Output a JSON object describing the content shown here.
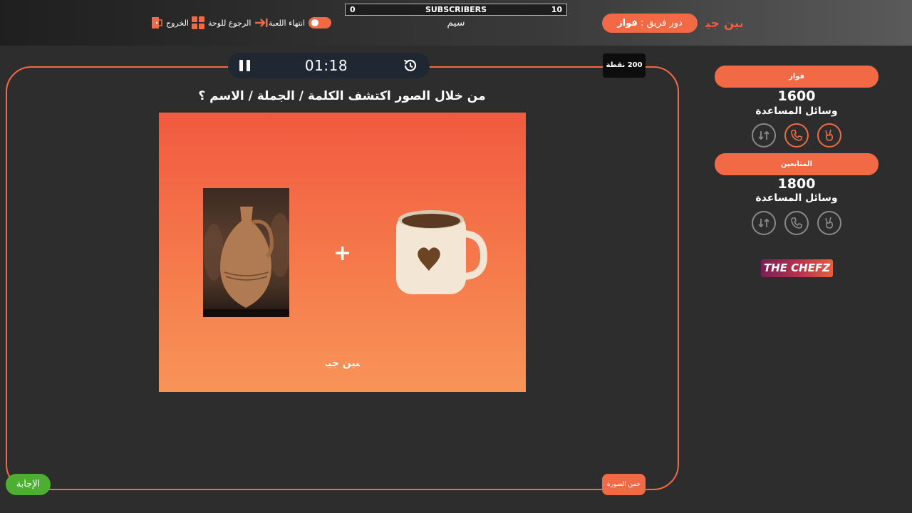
{
  "header": {
    "logo_text": "سين جيم",
    "turn_label": "دور فريق :",
    "turn_team": "فواز",
    "subscribers": {
      "left": "0",
      "label": "SUBSCRIBERS",
      "right": "10"
    },
    "channel_name": "سيم",
    "controls": {
      "end_game": "انتهاء اللعبة",
      "back_to_board": "الرجوع للوحة",
      "exit": "الخروج"
    }
  },
  "game": {
    "timer": "01:18",
    "points_badge": "200 نقطة",
    "question": "من خلال الصور اكتشف الكلمة / الجملة / الاسم ؟",
    "puzzle_plus": "+",
    "puzzle_logo": "سين جيم",
    "answer_button": "الإجابة",
    "guess_button": "خمن الصورة"
  },
  "teams": [
    {
      "name": "فواز",
      "score": "1600",
      "helps_label": "وسائل المساعدة",
      "active_lifelines": [
        "two-fingers-icon",
        "phone-icon"
      ],
      "inactive_lifelines": [
        "swap-icon"
      ]
    },
    {
      "name": "المتابعين",
      "score": "1800",
      "helps_label": "وسائل المساعدة",
      "active_lifelines": [],
      "inactive_lifelines": [
        "two-fingers-icon",
        "phone-icon",
        "swap-icon"
      ]
    }
  ],
  "sponsor": "THE CHEFZ",
  "colors": {
    "accent": "#f26a45",
    "answer": "#4caf2f",
    "background": "#2d2d2d"
  }
}
